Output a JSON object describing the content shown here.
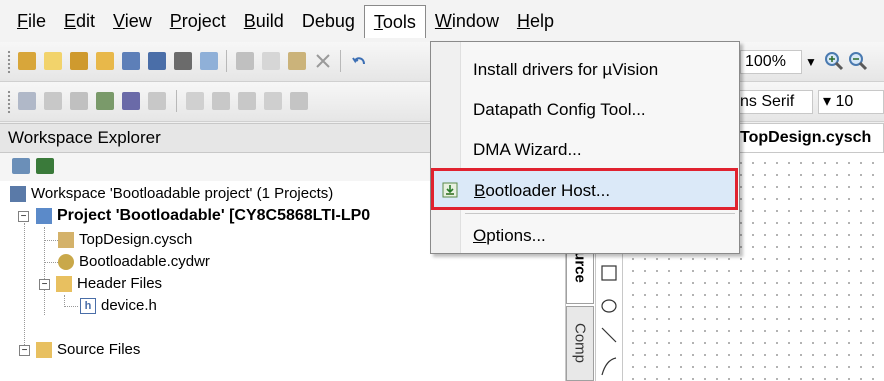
{
  "menubar": {
    "items": [
      {
        "accel": "F",
        "rest": "ile"
      },
      {
        "accel": "E",
        "rest": "dit"
      },
      {
        "accel": "V",
        "rest": "iew"
      },
      {
        "accel": "P",
        "rest": "roject"
      },
      {
        "accel": "B",
        "rest": "uild"
      },
      {
        "pre": "Debu",
        "accel": "g",
        "rest": ""
      },
      {
        "accel": "T",
        "rest": "ools"
      },
      {
        "accel": "W",
        "rest": "indow"
      },
      {
        "accel": "H",
        "rest": "elp"
      }
    ]
  },
  "toolbar": {
    "zoom_value": "100%",
    "font_value": "ns Serif",
    "size_value": "10"
  },
  "tools_menu": {
    "install_drivers": "Install drivers for µVision",
    "datapath_pre": "Datapath Confi",
    "datapath_accel": "g",
    "datapath_rest": " Tool...",
    "dma_wizard": "DMA Wizard...",
    "bootloader_accel": "B",
    "bootloader_rest": "ootloader Host...",
    "options_accel": "O",
    "options_rest": "ptions..."
  },
  "workspace": {
    "header": "Workspace Explorer",
    "root": "Workspace 'Bootloadable project' (1 Projects)",
    "project": "Project  'Bootloadable' [CY8C5868LTI-LP0",
    "files": {
      "topdesign": "TopDesign.cysch",
      "cydwr": "Bootloadable.cydwr",
      "header_folder": "Header Files",
      "device_h": "device.h",
      "source_folder": "Source Files"
    }
  },
  "document": {
    "tab_title": "TopDesign.cysch"
  },
  "side_tabs": {
    "source": "Source",
    "comp": "Comp"
  },
  "colors": {
    "highlight_box": "#e0222f",
    "menu_highlight": "#dbe9f8"
  }
}
